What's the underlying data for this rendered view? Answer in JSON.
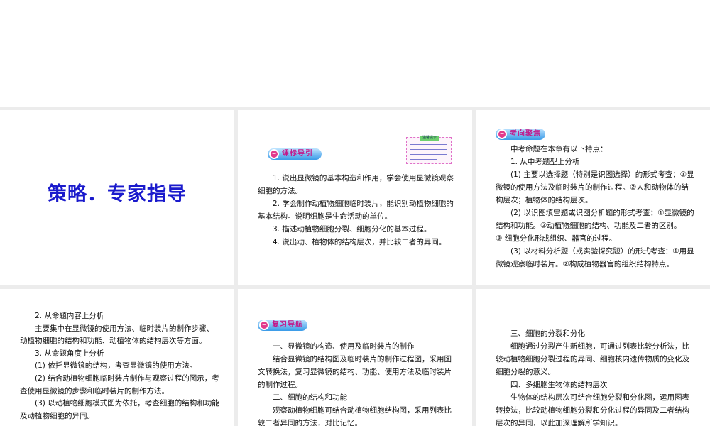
{
  "slides": [
    {
      "title": "策略．专家指导"
    },
    {
      "heading": "课标导引",
      "tip_title": "温馨提示",
      "lines": [
        "1. 说出显微镜的基本构造和作用，学会使用显微镜观察细胞的方法。",
        "2. 学会制作动植物细胞临时装片，能识别动植物细胞的基本结构。说明细胞是生命活动的单位。",
        "3. 描述动植物细胞分裂、细胞分化的基本过程。",
        "4. 说出动、植物体的结构层次，并比较二者的异同。"
      ]
    },
    {
      "heading": "考向聚焦",
      "lines": [
        "中考命题在本章有以下特点：",
        "1. 从中考题型上分析",
        "(1) 主要以选择题（特别是识图选择）的形式考查：①显微镜的使用方法及临时装片的制作过程。②人和动物体的结构层次；植物体的结构层次。",
        "(2) 以识图填空题或识图分析题的形式考查：①显微镜的结构和功能。②动植物细胞的结构、功能及二者的区别。",
        "③ 细胞分化形成组织、器官的过程。",
        "(3) 以材料分析题（或实验探究题）的形式考查：①用显微镜观察临时装片。②构成植物器官的组织结构特点。"
      ]
    },
    {
      "lines": [
        "2. 从命题内容上分析",
        "主要集中在显微镜的使用方法、临时装片的制作步骤、动植物细胞的结构和功能、动植物体的结构层次等方面。",
        "3. 从命题角度上分析",
        "(1) 依托显微镜的结构，考查显微镜的使用方法。",
        "(2) 结合动植物细胞临时装片制作与观察过程的图示，考查使用显微镜的步骤和临时装片的制作方法。",
        "(3) 以动植物细胞模式图为依托，考查细胞的结构和功能及动植物细胞的异同。"
      ]
    },
    {
      "heading": "复习导航",
      "lines": [
        "一、显微镜的构造、使用及临时装片的制作",
        "结合显微镜的结构图及临时装片的制作过程图，采用图文转换法，复习显微镜的结构、功能、使用方法及临时装片的制作过程。",
        "二、细胞的结构和功能",
        "观察动植物细胞可结合动植物细胞结构图，采用列表比较二者异同的方法，对比记忆。"
      ]
    },
    {
      "lines": [
        "三、细胞的分裂和分化",
        "细胞通过分裂产生新细胞，可通过列表比较分析法，比较动植物细胞分裂过程的异同、细胞核内遗传物质的变化及细胞分裂的意义。",
        "四、多细胞生物体的结构层次",
        "生物体的结构层次可结合细胞分裂和分化图，运用图表转换法，比较动植物细胞分裂和分化过程的异同及二者结构层次的异同，以此加深理解所学知识。"
      ]
    }
  ]
}
